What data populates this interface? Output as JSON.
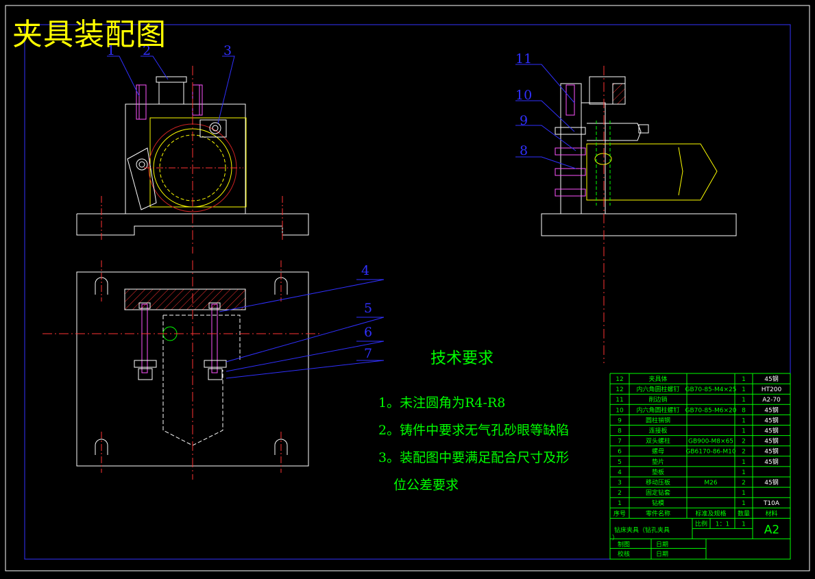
{
  "drawing": {
    "title": "夹具装配图",
    "balloons": [
      "1",
      "2",
      "3",
      "4",
      "5",
      "6",
      "7",
      "8",
      "9",
      "10",
      "11"
    ],
    "tech_requirements": {
      "heading": "技术要求",
      "items": [
        "1。未注圆角为R4-R8",
        "2。铸件中要求无气孔砂眼等缺陷",
        "3。装配图中要满足配合尺寸及形",
        "位公差要求"
      ]
    },
    "bom": {
      "rows": [
        {
          "no": "12",
          "name": "夹具体",
          "std": "",
          "qty": "1",
          "mat": "45钢"
        },
        {
          "no": "12",
          "name": "内六角圆柱螺钉",
          "std": "GB70-85-M4×25",
          "qty": "1",
          "mat": "HT200"
        },
        {
          "no": "11",
          "name": "削边销",
          "std": "",
          "qty": "1",
          "mat": "A2-70"
        },
        {
          "no": "10",
          "name": "内六角圆柱螺钉",
          "std": "GB70-85-M6×20",
          "qty": "8",
          "mat": "45钢"
        },
        {
          "no": "9",
          "name": "圆柱销钢",
          "std": "",
          "qty": "1",
          "mat": "45钢"
        },
        {
          "no": "8",
          "name": "连接板",
          "std": "",
          "qty": "1",
          "mat": "45钢"
        },
        {
          "no": "7",
          "name": "双头螺柱",
          "std": "GB900-M8×65",
          "qty": "2",
          "mat": "45钢"
        },
        {
          "no": "6",
          "name": "螺母",
          "std": "GB6170-86-M10",
          "qty": "2",
          "mat": "45钢"
        },
        {
          "no": "5",
          "name": "垫片",
          "std": "",
          "qty": "1",
          "mat": "45钢"
        },
        {
          "no": "4",
          "name": "垫板",
          "std": "",
          "qty": "1",
          "mat": ""
        },
        {
          "no": "3",
          "name": "移动压板",
          "std": "M26",
          "qty": "2",
          "mat": "45钢"
        },
        {
          "no": "2",
          "name": "固定钻套",
          "std": "",
          "qty": "1",
          "mat": ""
        },
        {
          "no": "1",
          "name": "钻模",
          "std": "",
          "qty": "1",
          "mat": "T10A"
        }
      ],
      "header": {
        "no": "序号",
        "name": "零件名称",
        "std": "标准及规格",
        "qty": "数量",
        "mat": "材料"
      },
      "title_block": {
        "part_name": "钻床夹具（钻孔夹具",
        "part_name_tail": "）",
        "scale_label": "比例",
        "scale_value": "1：1",
        "qty_value": "1",
        "sheet_size": "A2",
        "drawn_label": "制图",
        "checked_label": "校核",
        "date_label": "日期",
        "date_label2": "日期"
      }
    }
  }
}
